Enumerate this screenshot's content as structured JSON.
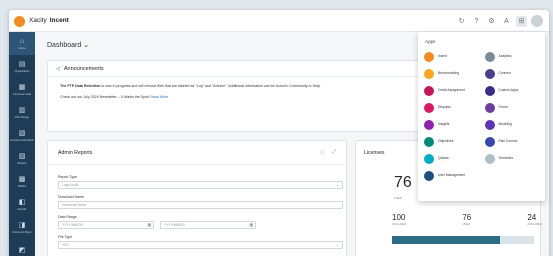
{
  "header": {
    "brand_part1": "Xacity",
    "brand_part2": "Incent",
    "icons": [
      "refresh-icon",
      "settings-icon",
      "gear-icon",
      "font-size-icon",
      "apps-grid-icon",
      "user-avatar"
    ]
  },
  "sidebar": {
    "items": [
      {
        "label": "Home",
        "icon": "home-icon",
        "glyph": "⌂"
      },
      {
        "label": "Organization",
        "icon": "org-icon",
        "glyph": "▤"
      },
      {
        "label": "Consumer Data",
        "icon": "data-icon",
        "glyph": "▦"
      },
      {
        "label": "Plan Design",
        "icon": "plan-icon",
        "glyph": "▥"
      },
      {
        "label": "Incentive Calculation",
        "icon": "calc-icon",
        "glyph": "▧"
      },
      {
        "label": "Reports",
        "icon": "reports-icon",
        "glyph": "▨"
      },
      {
        "label": "Utilities",
        "icon": "utilities-icon",
        "glyph": "▩"
      },
      {
        "label": "Results",
        "icon": "results-icon",
        "glyph": "◧"
      },
      {
        "label": "Document Mgmt",
        "icon": "docs-icon",
        "glyph": "◨"
      },
      {
        "label": "",
        "icon": "more-icon",
        "glyph": "◩"
      }
    ]
  },
  "breadcrumb": "Dashboard ⌄",
  "announcements": {
    "title": "Announcements",
    "line1_bold": "The FTP Data Retention",
    "line1_rest": " is now in progress and will remove files that are labeled as \"Log\" and \"Archive\". Additional information can be found in Community or Help.",
    "line2_text": "Check out our July 2024 Newsletter – X Marks the Spot!",
    "line2_link": "Read More"
  },
  "admin_reports": {
    "title": "Admin Reports",
    "report_type_label": "Report Type",
    "report_type_value": "Login Audit",
    "download_name_label": "Download Name",
    "download_name_placeholder": "Download Name",
    "date_range_label": "Date Range",
    "date_from_placeholder": "YYYY/MM/DD",
    "date_to_placeholder": "YYYY/MM/DD",
    "file_type_label": "File Type",
    "file_type_value": "CSV"
  },
  "licenses": {
    "title": "Licenses",
    "big_value": "76",
    "big_label": "USED",
    "stats": [
      {
        "value": "100",
        "label": "INCLUDED"
      },
      {
        "value": "76",
        "label": "USED"
      },
      {
        "value": "24",
        "label": "AVAILABLE"
      }
    ],
    "usage_fraction": 0.76,
    "bar_fill_color": "#2d6c86"
  },
  "apps_menu": {
    "title": "Apps",
    "items": [
      {
        "label": "Incent",
        "color": "#f28b22"
      },
      {
        "label": "Analytics",
        "color": "#7a8a99"
      },
      {
        "label": "Benchmarking",
        "color": "#f5a623"
      },
      {
        "label": "Connect",
        "color": "#4a3f8f"
      },
      {
        "label": "Credit Assignment",
        "color": "#c2185b"
      },
      {
        "label": "Custom Apps",
        "color": "#3b2c86"
      },
      {
        "label": "Disputes",
        "color": "#d81b60"
      },
      {
        "label": "Forms",
        "color": "#6a3fa0"
      },
      {
        "label": "Insights",
        "color": "#8e24aa"
      },
      {
        "label": "Modeling",
        "color": "#5e35b1"
      },
      {
        "label": "Objectives",
        "color": "#00897b"
      },
      {
        "label": "Plan Comms",
        "color": "#3949ab"
      },
      {
        "label": "Quotas",
        "color": "#00acc1"
      },
      {
        "label": "Territories",
        "color": "#b0bec5"
      },
      {
        "label": "User Management",
        "color": "#1e4e79"
      }
    ]
  }
}
